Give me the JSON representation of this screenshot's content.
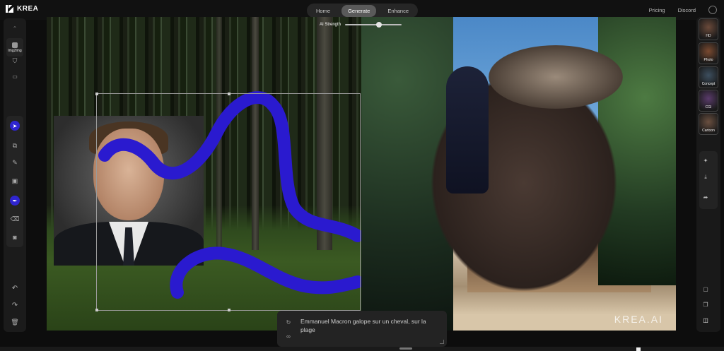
{
  "app": {
    "name": "KREA"
  },
  "modes": [
    {
      "label": "Home",
      "active": false
    },
    {
      "label": "Generate",
      "active": true
    },
    {
      "label": "Enhance",
      "active": false
    }
  ],
  "top_links": {
    "pricing": "Pricing",
    "discord": "Discord"
  },
  "left_toolbar": {
    "img2img_label": "Img2Img"
  },
  "ai_strength": {
    "label": "AI Strength",
    "value": 0.6
  },
  "prompt": {
    "text": "Emmanuel Macron galope sur un cheval, sur la plage"
  },
  "styles": [
    {
      "label": "HD",
      "color": "#6b4a3a"
    },
    {
      "label": "Photo",
      "color": "#7a4a30"
    },
    {
      "label": "Concept",
      "color": "#3d4f5f"
    },
    {
      "label": "CGI",
      "color": "#5a3b6b"
    },
    {
      "label": "Cartoon",
      "color": "#6b5040"
    }
  ],
  "watermark": "KREA.AI",
  "colors": {
    "accent": "#2f25d0",
    "brush_stroke": "#2a1acf"
  }
}
